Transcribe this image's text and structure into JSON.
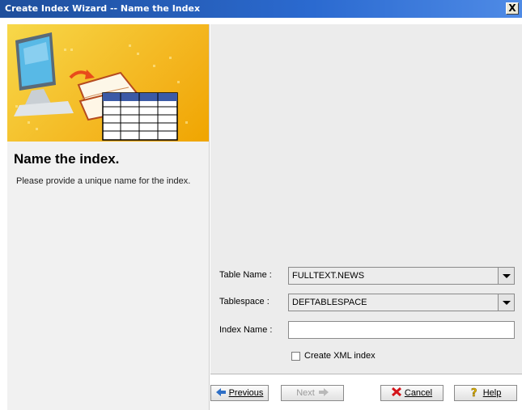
{
  "window": {
    "title": "Create Index Wizard -- Name the Index",
    "close_label": "X"
  },
  "left": {
    "heading": "Name the index.",
    "description": "Please provide a unique name for the index."
  },
  "form": {
    "table_name_label": "Table Name :",
    "table_name_value": "FULLTEXT.NEWS",
    "tablespace_label": "Tablespace :",
    "tablespace_value": "DEFTABLESPACE",
    "index_name_label": "Index Name :",
    "index_name_value": "",
    "create_xml_label": "Create XML index"
  },
  "buttons": {
    "previous": "Previous",
    "next": "Next",
    "cancel": "Cancel",
    "help": "Help"
  },
  "icons": {
    "previous": "back-arrow-icon",
    "next": "forward-arrow-icon",
    "cancel": "red-x-icon",
    "help": "question-mark-icon"
  }
}
